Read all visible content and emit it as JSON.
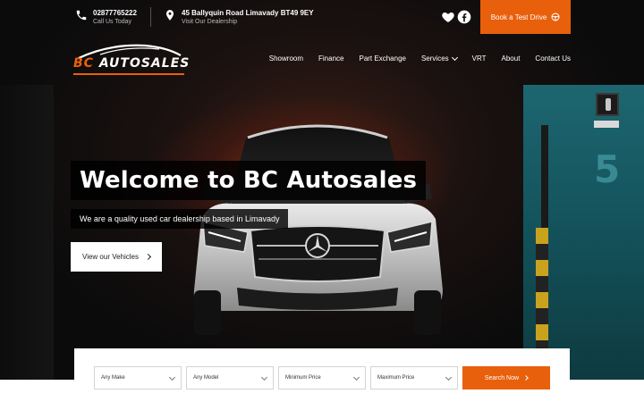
{
  "topbar": {
    "phone": {
      "number": "02877765222",
      "caption": "Call Us Today",
      "icon": "phone-icon"
    },
    "address": {
      "line": "45 Ballyquin Road Limavady BT49 9EY",
      "caption": "Visit Our Dealership",
      "icon": "map-pin-icon"
    },
    "social": [
      {
        "icon": "heart-icon"
      },
      {
        "icon": "facebook-icon"
      }
    ],
    "cta": {
      "label": "Book a Test Drive",
      "icon": "steering-wheel-icon"
    }
  },
  "logo": {
    "part1": "BC",
    "part2": " AUTOSALES"
  },
  "nav": {
    "items": [
      {
        "label": "Showroom"
      },
      {
        "label": "Finance"
      },
      {
        "label": "Part Exchange"
      },
      {
        "label": "Services"
      },
      {
        "label": "VRT"
      },
      {
        "label": "About"
      },
      {
        "label": "Contact Us"
      }
    ]
  },
  "hero": {
    "title": "Welcome to BC Autosales",
    "subtitle": "We are a quality used car dealership based in Limavady",
    "button": "View our Vehicles",
    "sign_number": "5"
  },
  "search": {
    "make": "Any Make",
    "model": "Any Model",
    "min_price": "Minimum Price",
    "max_price": "Maximum Price",
    "button": "Search Now"
  },
  "colors": {
    "accent": "#e8600c",
    "dark": "#0b0b0b",
    "teal": "#1d6670"
  }
}
